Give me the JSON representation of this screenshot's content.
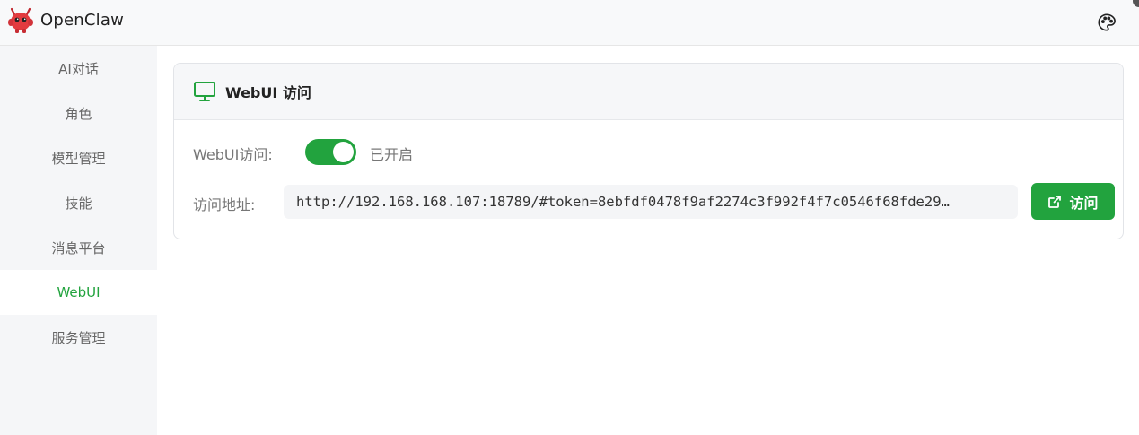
{
  "app": {
    "title": "OpenClaw",
    "logo_icon": "red-robot-mascot-icon",
    "theme_icon": "palette-icon",
    "accent_color": "#22a33e"
  },
  "sidebar": {
    "items": [
      {
        "label": "AI对话",
        "active": false
      },
      {
        "label": "角色",
        "active": false
      },
      {
        "label": "模型管理",
        "active": false
      },
      {
        "label": "技能",
        "active": false
      },
      {
        "label": "消息平台",
        "active": false
      },
      {
        "label": "WebUI",
        "active": true
      },
      {
        "label": "服务管理",
        "active": false
      }
    ]
  },
  "card": {
    "icon": "monitor-icon",
    "title": "WebUI 访问",
    "toggle_label": "WebUI访问:",
    "toggle_on": true,
    "toggle_status": "已开启",
    "url_label": "访问地址:",
    "url_value": "http://192.168.168.107:18789/#token=8ebfdf0478f9af2274c3f992f4f7c0546f68fde29…",
    "visit_icon": "external-link-icon",
    "visit_label": "访问"
  }
}
